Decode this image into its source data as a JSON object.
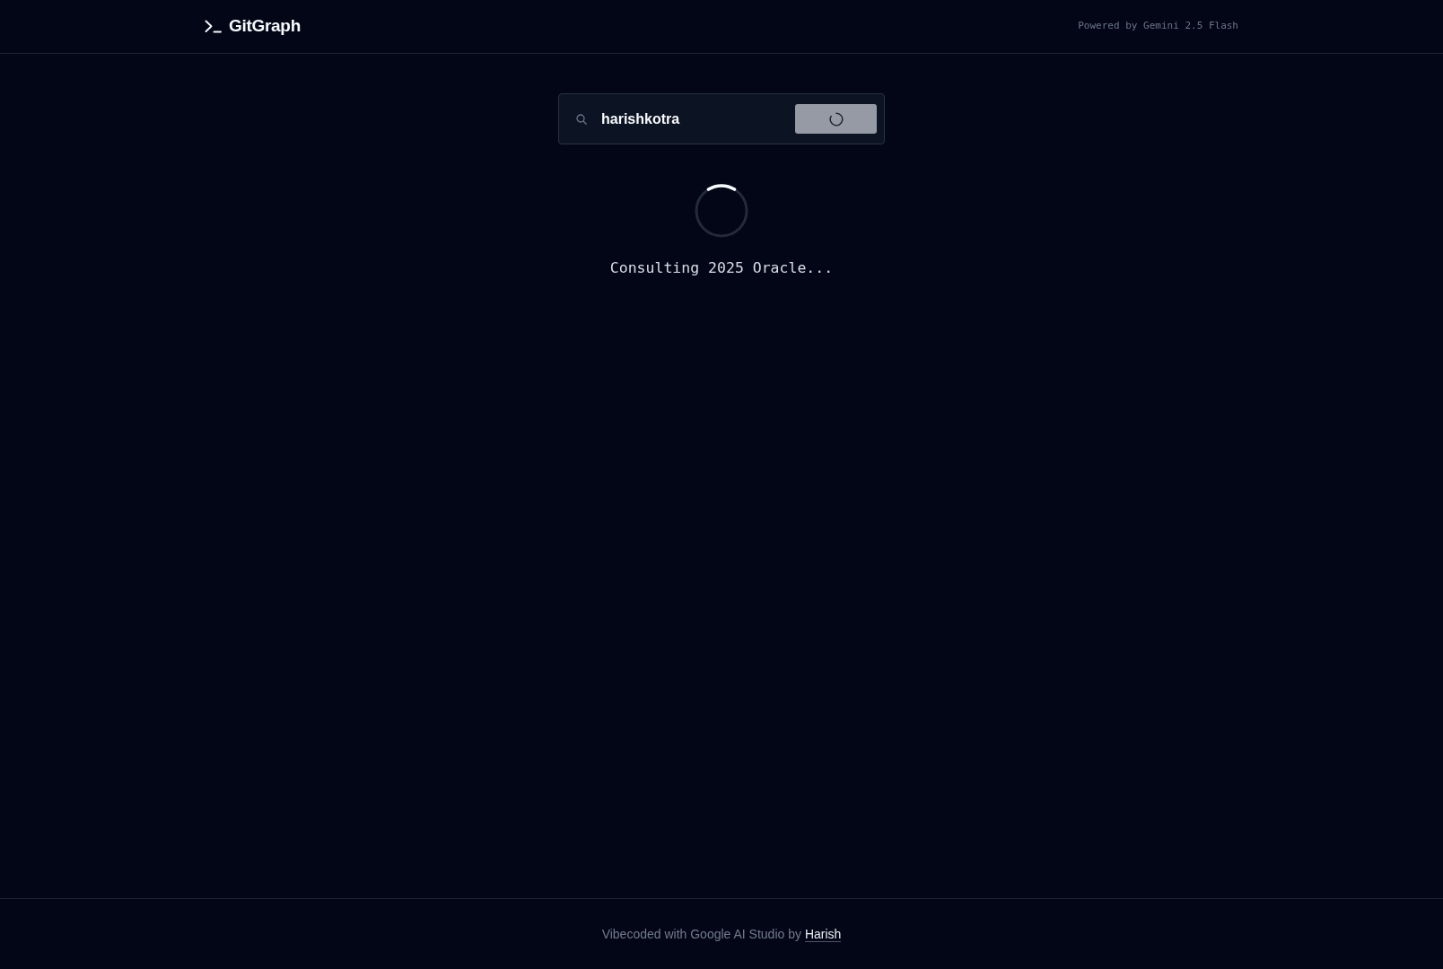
{
  "header": {
    "title": "GitGraph",
    "tagline": "Powered by Gemini 2.5 Flash"
  },
  "search": {
    "value": "harishkotra",
    "button": {
      "loading": true
    }
  },
  "status": {
    "message": "Consulting 2025 Oracle..."
  },
  "footer": {
    "text": "Vibecoded with Google AI Studio by",
    "link": "Harish"
  }
}
